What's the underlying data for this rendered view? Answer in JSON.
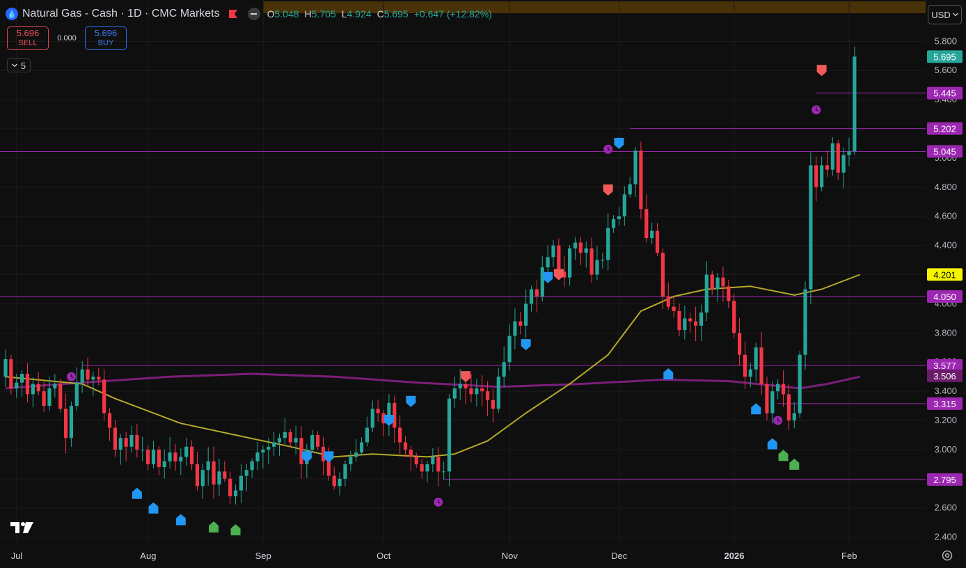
{
  "header": {
    "symbol_title": "Natural Gas - Cash · 1D · CMC Markets",
    "ohlc": {
      "open_label": "O",
      "open": "5.048",
      "high_label": "H",
      "high": "5.705",
      "low_label": "L",
      "low": "4.924",
      "close_label": "C",
      "close": "5.695",
      "change": "+0.647 (+12.82%)"
    },
    "icons": [
      "flame-icon",
      "flag-icon",
      "hide-indicators-icon"
    ]
  },
  "trade": {
    "sell_price": "5.696",
    "sell_label": "SELL",
    "spread": "0.000",
    "buy_price": "5.696",
    "buy_label": "BUY"
  },
  "indicators_toggle": {
    "count": "5"
  },
  "currency": {
    "label": "USD"
  },
  "colors": {
    "up": "#26a69a",
    "down": "#f23645",
    "ma_fast": "#b5a92a",
    "ma_slow": "#7b1e7a",
    "level_line": "#9c27b0",
    "buy_marker": "#2196f3",
    "sell_marker": "#f25a5a",
    "green_marker": "#4caf50"
  },
  "chart_data": {
    "type": "candlestick",
    "y_range": [
      2.36,
      5.94
    ],
    "y_ticks": [
      "5.800",
      "5.600",
      "5.400",
      "5.200",
      "5.000",
      "4.800",
      "4.600",
      "4.400",
      "4.200",
      "4.000",
      "3.800",
      "3.600",
      "3.400",
      "3.200",
      "3.000",
      "2.800",
      "2.600",
      "2.400"
    ],
    "x_ticks": [
      {
        "label": "Jul",
        "bar": 0
      },
      {
        "label": "Aug",
        "bar": 24
      },
      {
        "label": "Sep",
        "bar": 45
      },
      {
        "label": "Oct",
        "bar": 67
      },
      {
        "label": "Nov",
        "bar": 90
      },
      {
        "label": "Dec",
        "bar": 110
      },
      {
        "label": "2026",
        "bar": 131,
        "bold": true
      },
      {
        "label": "Feb",
        "bar": 152
      }
    ],
    "price_labels": [
      {
        "value": 5.695,
        "text": "5.695",
        "kind": "last"
      },
      {
        "value": 5.445,
        "text": "5.445",
        "kind": "level"
      },
      {
        "value": 5.202,
        "text": "5.202",
        "kind": "level"
      },
      {
        "value": 5.045,
        "text": "5.045",
        "kind": "level"
      },
      {
        "value": 4.201,
        "text": "4.201",
        "kind": "ma_fast"
      },
      {
        "value": 4.05,
        "text": "4.050",
        "kind": "level"
      },
      {
        "value": 3.577,
        "text": "3.577",
        "kind": "level"
      },
      {
        "value": 3.506,
        "text": "3.506",
        "kind": "ma_slow"
      },
      {
        "value": 3.315,
        "text": "3.315",
        "kind": "level"
      },
      {
        "value": 2.795,
        "text": "2.795",
        "kind": "level"
      }
    ],
    "levels": [
      {
        "value": 5.445,
        "from_bar": 148
      },
      {
        "value": 5.202,
        "from_bar": 114
      },
      {
        "value": 5.045,
        "from_bar": -1
      },
      {
        "value": 4.05,
        "from_bar": -1
      },
      {
        "value": 3.577,
        "from_bar": 14
      },
      {
        "value": 3.315,
        "from_bar": 141
      },
      {
        "value": 2.795,
        "from_bar": 80
      }
    ],
    "closes": [
      3.62,
      3.42,
      3.46,
      3.52,
      3.38,
      3.45,
      3.4,
      3.3,
      3.42,
      3.45,
      3.28,
      3.08,
      3.3,
      3.46,
      3.55,
      3.48,
      3.5,
      3.48,
      3.25,
      3.15,
      3.0,
      3.08,
      3.02,
      3.1,
      3.0,
      3.0,
      2.9,
      3.0,
      2.88,
      2.92,
      2.98,
      2.92,
      2.95,
      3.02,
      2.9,
      2.75,
      2.86,
      2.92,
      2.76,
      2.85,
      2.8,
      2.68,
      2.72,
      2.82,
      2.86,
      2.92,
      2.98,
      3.0,
      3.02,
      3.05,
      3.08,
      3.12,
      3.05,
      3.08,
      2.9,
      3.0,
      3.1,
      3.02,
      2.92,
      2.82,
      2.75,
      2.8,
      2.9,
      2.95,
      2.98,
      3.05,
      3.15,
      3.28,
      3.25,
      3.18,
      3.32,
      3.15,
      3.05,
      3.0,
      2.95,
      2.9,
      2.85,
      2.9,
      2.95,
      2.85,
      2.85,
      3.35,
      3.42,
      3.45,
      3.42,
      3.38,
      3.42,
      3.4,
      3.34,
      3.28,
      3.5,
      3.6,
      3.78,
      3.88,
      3.85,
      4.0,
      4.1,
      4.05,
      4.25,
      4.32,
      4.4,
      4.22,
      4.18,
      4.38,
      4.42,
      4.35,
      4.38,
      4.2,
      4.3,
      4.3,
      4.52,
      4.58,
      4.6,
      4.75,
      4.82,
      5.05,
      4.65,
      4.45,
      4.5,
      4.35,
      4.05,
      3.98,
      3.95,
      3.82,
      3.9,
      3.88,
      3.85,
      3.94,
      4.2,
      4.1,
      4.18,
      4.12,
      4.02,
      3.8,
      3.65,
      3.5,
      3.55,
      3.7,
      3.45,
      3.25,
      3.4,
      3.45,
      3.38,
      3.2,
      3.25,
      3.65,
      4.1,
      4.95,
      4.8,
      4.95,
      4.92,
      5.1,
      4.9,
      5.02,
      5.045,
      5.695
    ],
    "ma_fast_points": [
      [
        0,
        3.5
      ],
      [
        14,
        3.45
      ],
      [
        20,
        3.35
      ],
      [
        32,
        3.18
      ],
      [
        42,
        3.1
      ],
      [
        52,
        3.02
      ],
      [
        60,
        2.95
      ],
      [
        67,
        2.97
      ],
      [
        77,
        2.95
      ],
      [
        82,
        2.97
      ],
      [
        88,
        3.06
      ],
      [
        95,
        3.25
      ],
      [
        103,
        3.45
      ],
      [
        110,
        3.65
      ],
      [
        116,
        3.95
      ],
      [
        122,
        4.05
      ],
      [
        128,
        4.1
      ],
      [
        136,
        4.12
      ],
      [
        144,
        4.06
      ],
      [
        149,
        4.1
      ],
      [
        156,
        4.2
      ]
    ],
    "ma_slow_points": [
      [
        0,
        3.42
      ],
      [
        14,
        3.46
      ],
      [
        30,
        3.5
      ],
      [
        45,
        3.52
      ],
      [
        60,
        3.5
      ],
      [
        75,
        3.46
      ],
      [
        90,
        3.43
      ],
      [
        105,
        3.45
      ],
      [
        120,
        3.48
      ],
      [
        132,
        3.47
      ],
      [
        140,
        3.44
      ],
      [
        145,
        3.42
      ],
      [
        150,
        3.45
      ],
      [
        156,
        3.5
      ]
    ],
    "markers": [
      {
        "bar": 112,
        "kind": "buy",
        "above": true,
        "value": 5.1
      },
      {
        "bar": 99,
        "kind": "buy",
        "above": true,
        "value": 4.18
      },
      {
        "bar": 95,
        "kind": "buy",
        "above": true,
        "value": 3.72
      },
      {
        "bar": 74,
        "kind": "buy",
        "above": true,
        "value": 3.33
      },
      {
        "bar": 70,
        "kind": "buy",
        "above": true,
        "value": 3.2
      },
      {
        "bar": 55,
        "kind": "buy",
        "above": true,
        "value": 2.95
      },
      {
        "bar": 59,
        "kind": "buy",
        "above": true,
        "value": 2.95
      },
      {
        "bar": 101,
        "kind": "sell",
        "above": true,
        "value": 4.2
      },
      {
        "bar": 84,
        "kind": "sell",
        "above": true,
        "value": 3.5
      },
      {
        "bar": 110,
        "kind": "sell",
        "above": true,
        "value": 4.78
      },
      {
        "bar": 149,
        "kind": "sell",
        "above": true,
        "value": 5.6
      },
      {
        "bar": 24,
        "kind": "buy",
        "above": false,
        "value": 2.7
      },
      {
        "bar": 27,
        "kind": "buy",
        "above": false,
        "value": 2.6
      },
      {
        "bar": 32,
        "kind": "buy",
        "above": false,
        "value": 2.52
      },
      {
        "bar": 38,
        "kind": "green",
        "above": false,
        "value": 2.47
      },
      {
        "bar": 42,
        "kind": "green",
        "above": false,
        "value": 2.45
      },
      {
        "bar": 121,
        "kind": "buy",
        "above": false,
        "value": 3.52
      },
      {
        "bar": 137,
        "kind": "buy",
        "above": false,
        "value": 3.28
      },
      {
        "bar": 140,
        "kind": "buy",
        "above": false,
        "value": 3.04
      },
      {
        "bar": 142,
        "kind": "green",
        "above": false,
        "value": 2.96
      },
      {
        "bar": 144,
        "kind": "green",
        "above": false,
        "value": 2.9
      }
    ],
    "alerts": [
      {
        "bar": 12,
        "value": 3.5
      },
      {
        "bar": 79,
        "value": 2.64
      },
      {
        "bar": 110,
        "value": 5.06
      },
      {
        "bar": 141,
        "value": 3.2
      },
      {
        "bar": 148,
        "value": 5.33
      }
    ]
  }
}
